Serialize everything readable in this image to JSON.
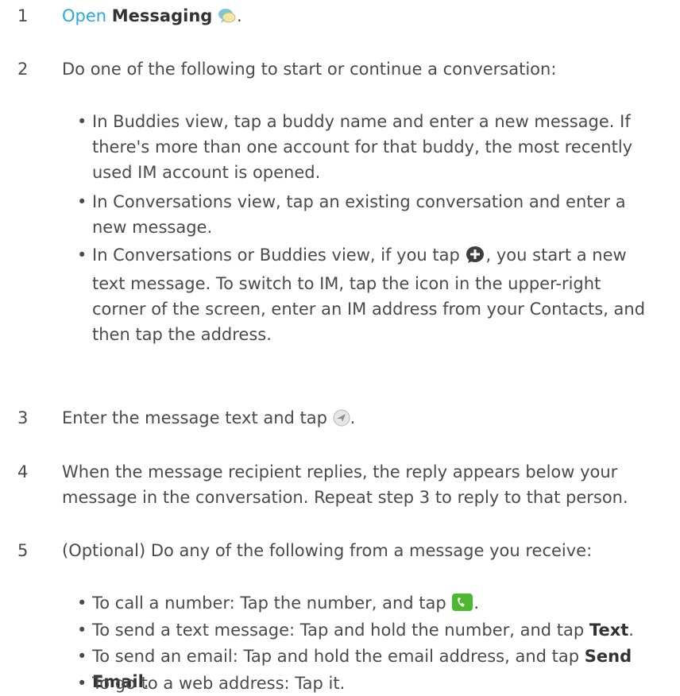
{
  "step1": {
    "num": "1",
    "link": "Open",
    "app": "Messaging",
    "app_icon": "messaging-app-icon",
    "end": "."
  },
  "step2": {
    "num": "2",
    "text": "Do one of the following to start or continue a conversation:",
    "bullets": {
      "b1": {
        "text": "In Buddies view, tap a buddy name and enter a new message. If there's more than one account for that buddy, the most recently used IM account is opened."
      },
      "b2": {
        "text": "In Conversations view, tap an existing conversation and enter a new message."
      },
      "b3": {
        "pre": "In Conversations or Buddies view, if you tap",
        "icon": "new-message-icon",
        "post": ", you start a new text message. To switch to IM, tap the icon in the upper-right corner of the screen, enter an IM address from your Contacts, and then tap the address."
      }
    }
  },
  "step3": {
    "num": "3",
    "pre": "Enter the message text and tap",
    "icon": "send-icon",
    "post": "."
  },
  "step4": {
    "num": "4",
    "text": "When the message recipient replies, the reply appears below your message in the conversation. Repeat step 3 to reply to that person."
  },
  "step5": {
    "num": "5",
    "text": "(Optional) Do any of the following from a message you receive:",
    "bullets": {
      "b1": {
        "pre": "To call a number: Tap the number, and tap",
        "icon": "phone-call-icon",
        "post": "."
      },
      "b2": {
        "pre": "To send a text message: Tap and hold the number, and tap",
        "bold": "Text",
        "post": "."
      },
      "b3": {
        "pre": "To send an email: Tap and hold the email address, and tap",
        "bold": "Send Email",
        "post": "."
      },
      "b4": {
        "text": "To go to a web address: Tap it."
      }
    }
  },
  "bullet_char": "•",
  "colors": {
    "text": "#4a4a4a",
    "link": "#2aa9dd",
    "bold": "#333333"
  }
}
